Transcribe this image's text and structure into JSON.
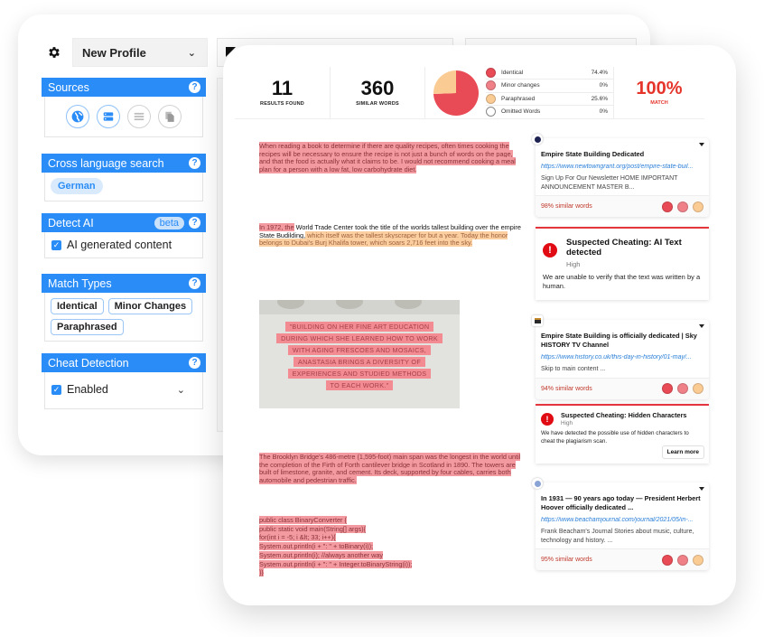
{
  "colors": {
    "accent": "#2a8cf6",
    "identical": "#e84b55",
    "minor": "#ef8088",
    "paraphrased": "#fbcb94",
    "omitted": "#ffffff",
    "match": "#e5352b",
    "alert": "#e10b14"
  },
  "settings": {
    "profile": {
      "icon": "gear-icon",
      "value": "New Profile"
    },
    "sources": {
      "title": "Sources",
      "icons": [
        {
          "name": "internet-icon",
          "active": true
        },
        {
          "name": "database-icon",
          "active": true
        },
        {
          "name": "list-icon",
          "active": false
        },
        {
          "name": "copy-files-icon",
          "active": false
        }
      ]
    },
    "cross_language": {
      "title": "Cross language search",
      "language": "German"
    },
    "detect_ai": {
      "title": "Detect AI",
      "badge": "beta",
      "option": "AI generated content",
      "checked": true
    },
    "match_types": {
      "title": "Match Types",
      "chips": [
        "Identical",
        "Minor Changes",
        "Paraphrased"
      ]
    },
    "cheat_detection": {
      "title": "Cheat Detection",
      "option": "Enabled",
      "checked": true
    }
  },
  "summary": {
    "results": {
      "value": "11",
      "label": "RESULTS FOUND"
    },
    "words": {
      "value": "360",
      "label": "SIMILAR WORDS"
    },
    "legend": [
      {
        "label": "Identical",
        "value": "74.4%"
      },
      {
        "label": "Minor changes",
        "value": "0%"
      },
      {
        "label": "Paraphrased",
        "value": "25.6%"
      },
      {
        "label": "Omitted Words",
        "value": "0%"
      }
    ],
    "match": {
      "value": "100%",
      "label": "MATCH"
    }
  },
  "chart_data": {
    "type": "pie",
    "title": "",
    "categories": [
      "Identical",
      "Minor changes",
      "Paraphrased",
      "Omitted Words"
    ],
    "values": [
      74.4,
      0,
      25.6,
      0
    ],
    "colors": [
      "#e84b55",
      "#ef8088",
      "#fbcb94",
      "#ffffff"
    ],
    "legend": "right"
  },
  "document": {
    "p1": "When reading a book to determine if there are quality recipes, often times cooking the recipes will be necessary to ensure the recipe is not just a bunch of words on the page, and that the food is actually what it claims to be. I would not recommend cooking a meal plan for a person with a low fat, low carbohydrate diet.",
    "p2_identical": "In 1972, the",
    "p2_plain": " World Trade Center took the title of the worlds tallest building over the empire State Budilding,",
    "p2_paraphrased": " which itself was the tallest skyscraper for but a year. Today the honor belongs to Dubai's Burj Khalifa tower, which soars 2,716 feet into the sky.",
    "image_lines": [
      "\"BUILDING ON HER FINE ART EDUCATION",
      "DURING WHICH SHE LEARNED HOW TO WORK",
      "WITH AGING FRESCOES AND MOSAICS,",
      "ANASTASIA BRINGS A DIVERSITY OF",
      "EXPERIENCES AND STUDIED METHODS",
      "TO EACH WORK.\""
    ],
    "p3": "The Brooklyn Bridge's 486-metre (1,595-foot) main span was the longest in the world until the completion of the Firth of Forth cantilever bridge in Scotland in 1890. The towers are built of limestone, granite, and cement. Its deck, supported by four cables, carries both automobile and pedestrian traffic.",
    "code": [
      "public class BinaryConverter {",
      "public static void main(String[] args){",
      "for(int i = -5; i &lt; 33; i++){",
      "System.out.println(i + \": \" + toBinary(i));",
      "System.out.println(i); //always another way",
      "System.out.println(i + \": \" + Integer.toBinaryString(i));",
      "}}"
    ]
  },
  "results": [
    {
      "title": "Empire State Building Dedicated",
      "url": "https://www.newtowngrant.org/post/empire-state-buil...",
      "desc": "Sign Up For Our Newsletter HOME IMPORTANT ANNOUNCEMENT MASTER B...",
      "similar": "98% similar words"
    },
    {
      "title": "Empire State Building is officially dedicated | Sky HISTORY TV Channel",
      "url": "https://www.history.co.uk/this-day-in-history/01-may/...",
      "desc": "Skip to main content ...",
      "similar": "94% similar words"
    },
    {
      "title": "In 1931 — 90 years ago today — President Herbert Hoover officially dedicated ...",
      "url": "https://www.beachamjournal.com/journal/2021/05/in-...",
      "desc": "Frank Beacham's Journal Stories about music, culture, technology and history. ...",
      "similar": "95% similar words"
    }
  ],
  "alerts": [
    {
      "title": "Suspected Cheating: AI Text detected",
      "severity": "High",
      "text": "We are unable to verify that the text was written by a human."
    },
    {
      "title": "Suspected Cheating: Hidden Characters",
      "severity": "High",
      "text": "We have detected the possible use of hidden characters to cheat the plagiarism scan.",
      "button": "Learn more"
    }
  ]
}
